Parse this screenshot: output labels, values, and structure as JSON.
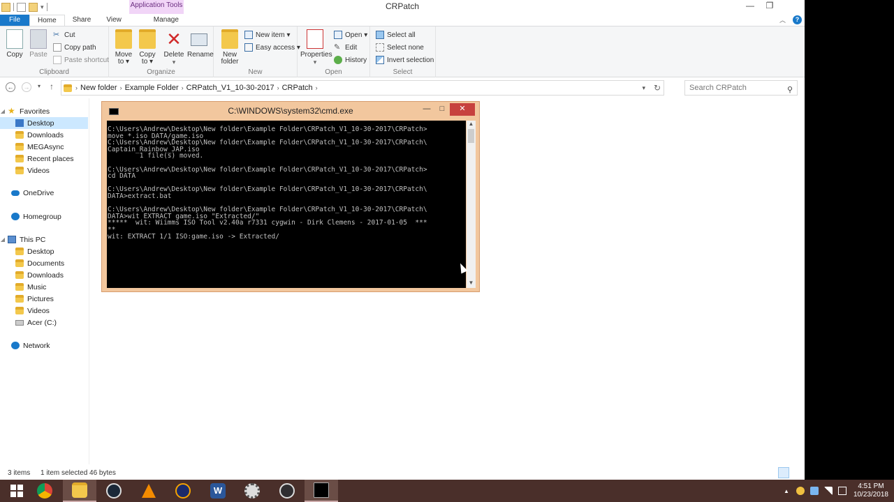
{
  "window": {
    "title": "CRPatch",
    "contextual_tab": "Application Tools",
    "buttons": {
      "minimize": "—",
      "restore": "❐",
      "close": "✕"
    }
  },
  "ribbon_tabs": [
    {
      "label": "File"
    },
    {
      "label": "Home"
    },
    {
      "label": "Share"
    },
    {
      "label": "View"
    },
    {
      "label": "Manage"
    }
  ],
  "ribbon": {
    "clipboard": {
      "label": "Clipboard",
      "copy": "Copy",
      "paste": "Paste",
      "cut": "Cut",
      "copy_path": "Copy path",
      "paste_shortcut": "Paste shortcut"
    },
    "organize": {
      "label": "Organize",
      "move_to": "Move to ▾",
      "move_to_l1": "Move",
      "move_to_l2": "to ▾",
      "copy_to_l1": "Copy",
      "copy_to_l2": "to ▾",
      "delete": "Delete",
      "rename": "Rename"
    },
    "new": {
      "label": "New",
      "new_folder_l1": "New",
      "new_folder_l2": "folder",
      "new_item": "New item ▾",
      "easy_access": "Easy access ▾"
    },
    "open": {
      "label": "Open",
      "properties": "Properties",
      "open": "Open ▾",
      "edit": "Edit",
      "history": "History"
    },
    "select": {
      "label": "Select",
      "select_all": "Select all",
      "select_none": "Select none",
      "invert_selection": "Invert selection"
    }
  },
  "address": {
    "crumbs": [
      "New folder",
      "Example Folder",
      "CRPatch_V1_10-30-2017",
      "CRPatch"
    ],
    "search_placeholder": "Search CRPatch"
  },
  "nav": {
    "favorites": "Favorites",
    "favorites_items": [
      "Desktop",
      "Downloads",
      "MEGAsync",
      "Recent places",
      "Videos"
    ],
    "onedrive": "OneDrive",
    "homegroup": "Homegroup",
    "thispc": "This PC",
    "thispc_items": [
      "Desktop",
      "Documents",
      "Downloads",
      "Music",
      "Pictures",
      "Videos",
      "Acer (C:)"
    ],
    "network": "Network"
  },
  "status": {
    "items": "3 items",
    "selected": "1 item selected  46 bytes"
  },
  "cmd": {
    "title": "C:\\WINDOWS\\system32\\cmd.exe",
    "lines": [
      "C:\\Users\\Andrew\\Desktop\\New folder\\Example Folder\\CRPatch_V1_10-30-2017\\CRPatch>",
      "move *.iso DATA/game.iso",
      "C:\\Users\\Andrew\\Desktop\\New folder\\Example Folder\\CRPatch_V1_10-30-2017\\CRPatch\\",
      "Captain_Rainbow_JAP.iso",
      "        1 file(s) moved.",
      "",
      "C:\\Users\\Andrew\\Desktop\\New folder\\Example Folder\\CRPatch_V1_10-30-2017\\CRPatch>",
      "cd DATA",
      "",
      "C:\\Users\\Andrew\\Desktop\\New folder\\Example Folder\\CRPatch_V1_10-30-2017\\CRPatch\\",
      "DATA>extract.bat",
      "",
      "C:\\Users\\Andrew\\Desktop\\New folder\\Example Folder\\CRPatch_V1_10-30-2017\\CRPatch\\",
      "DATA>wit EXTRACT game.iso \"Extracted/\"",
      "*****  wit: Wiimms ISO Tool v2.40a r7331 cygwin - Dirk Clemens - 2017-01-05  ***",
      "**",
      "wit: EXTRACT 1/1 ISO:game.iso -> Extracted/"
    ]
  },
  "taskbar": {
    "apps": [
      "start-icon",
      "chrome-icon",
      "file-explorer-icon",
      "steam-icon",
      "vlc-icon",
      "audacity-icon",
      "word-icon",
      "settings-app-icon",
      "obs-icon",
      "cmd-icon"
    ],
    "time": "4:51 PM",
    "date": "10/23/2018"
  },
  "colors": {
    "file_tab": "#1979ca",
    "selection": "#cce8ff",
    "cmd_frame": "#f2c79e",
    "cmd_close": "#c7413e",
    "taskbar": "#4a2f2a"
  }
}
